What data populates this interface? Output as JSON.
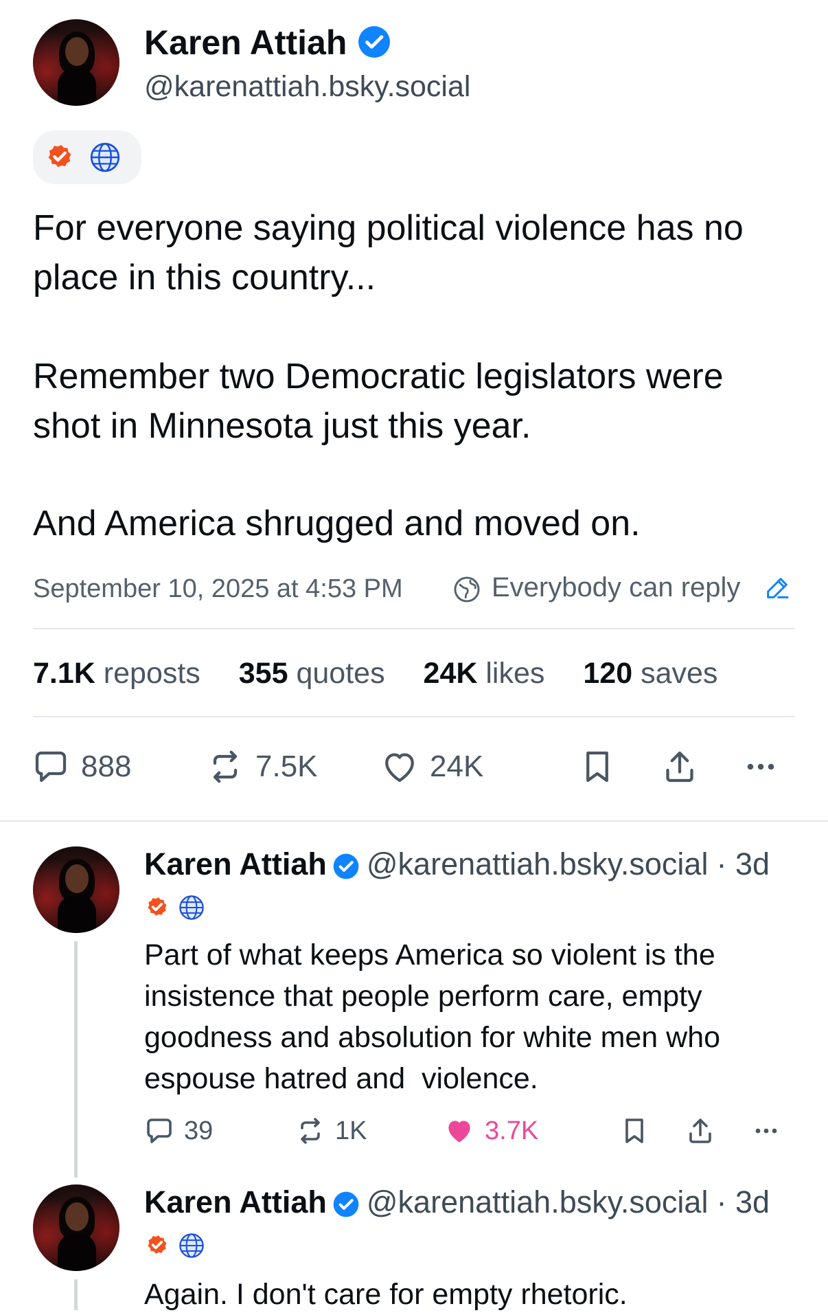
{
  "main_post": {
    "author_name": "Karen Attiah",
    "author_handle": "@karenattiah.bsky.social",
    "paragraph_1": "For everyone saying political violence has no place in this country...",
    "paragraph_2": "Remember two Democratic legislators were shot in Minnesota just this year.",
    "paragraph_3": "And America shrugged and moved on.",
    "timestamp": "September 10, 2025 at 4:53 PM",
    "reply_setting": "Everybody can reply",
    "stats": {
      "reposts_num": "7.1K",
      "reposts_lbl": "reposts",
      "quotes_num": "355",
      "quotes_lbl": "quotes",
      "likes_num": "24K",
      "likes_lbl": "likes",
      "saves_num": "120",
      "saves_lbl": "saves"
    },
    "actions": {
      "reply_count": "888",
      "repost_count": "7.5K",
      "like_count": "24K"
    }
  },
  "replies": [
    {
      "author_name": "Karen Attiah",
      "author_handle": "@karenattiah.bsky.social",
      "age": "· 3d",
      "text": "Part of what keeps America so violent is the insistence that people perform care, empty goodness and absolution for white men who espouse hatred and  violence.",
      "reply_count": "39",
      "repost_count": "1K",
      "like_count": "3.7K"
    },
    {
      "author_name": "Karen Attiah",
      "author_handle": "@karenattiah.bsky.social",
      "age": "· 3d",
      "text": "Again. I don't care for empty rhetoric."
    }
  ],
  "colors": {
    "verified_blue": "#1083fe",
    "liked_pink": "#ec4899",
    "link_blue": "#1083fe",
    "badge_orange": "#f4511e"
  },
  "icons": [
    "verified-icon",
    "bluesky-check-badge-icon",
    "globe-icon",
    "reply-icon",
    "repost-icon",
    "heart-icon",
    "bookmark-icon",
    "share-icon",
    "more-icon",
    "edit-pencil-icon",
    "earth-reply-icon"
  ]
}
